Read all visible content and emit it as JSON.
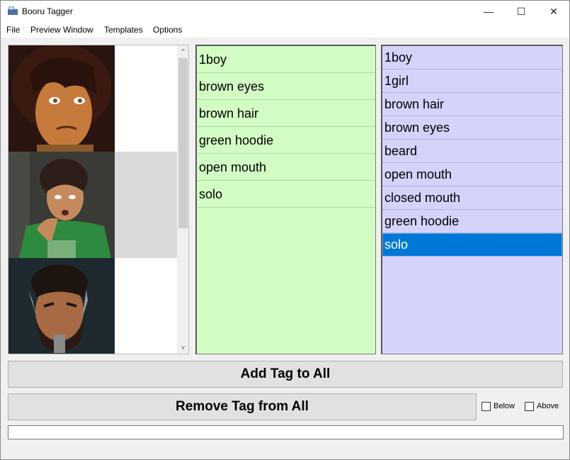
{
  "window": {
    "title": "Booru Tagger",
    "minimize_glyph": "—",
    "maximize_glyph": "☐",
    "close_glyph": "✕"
  },
  "menu": [
    "File",
    "Preview Window",
    "Templates",
    "Options"
  ],
  "image_list": {
    "items": [
      {
        "icon": "portrait-woman-brown-curly-hair",
        "selected": false
      },
      {
        "icon": "portrait-boy-green-hoodie",
        "selected": true
      },
      {
        "icon": "portrait-man-beard",
        "selected": false
      }
    ],
    "scroll_up_glyph": "^",
    "scroll_down_glyph": "v"
  },
  "current_tags": [
    "1boy",
    "brown eyes",
    "brown hair",
    "green hoodie",
    "open mouth",
    "solo"
  ],
  "all_tags": {
    "items": [
      "1boy",
      "1girl",
      "brown hair",
      "brown eyes",
      "beard",
      "open mouth",
      "closed mouth",
      "green hoodie",
      "solo"
    ],
    "selected_index": 8
  },
  "actions": {
    "add_label": "Add Tag to All",
    "remove_label": "Remove Tag from All",
    "below_label": "Below",
    "above_label": "Above",
    "tag_input_value": ""
  },
  "colors": {
    "current_tags_bg": "#d3fcc4",
    "all_tags_bg": "#d4d3fc",
    "selection": "#0078d7"
  }
}
